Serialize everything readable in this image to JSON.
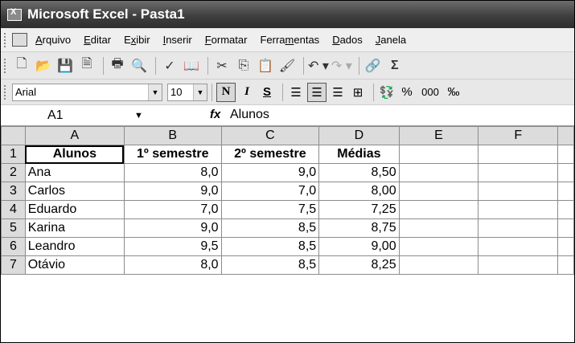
{
  "window": {
    "title": "Microsoft Excel - Pasta1"
  },
  "menu": [
    {
      "pre": "",
      "u": "A",
      "post": "rquivo"
    },
    {
      "pre": "",
      "u": "E",
      "post": "ditar"
    },
    {
      "pre": "E",
      "u": "x",
      "post": "ibir"
    },
    {
      "pre": "",
      "u": "I",
      "post": "nserir"
    },
    {
      "pre": "",
      "u": "F",
      "post": "ormatar"
    },
    {
      "pre": "Ferra",
      "u": "m",
      "post": "entas"
    },
    {
      "pre": "",
      "u": "D",
      "post": "ados"
    },
    {
      "pre": "",
      "u": "J",
      "post": "anela"
    }
  ],
  "format_toolbar": {
    "font": "Arial",
    "size": "10",
    "bold": "N",
    "italic": "I",
    "underline": "S",
    "percent": "%",
    "thousands": "000",
    "decimal": "‰"
  },
  "standard_toolbar": {
    "sum": "Σ"
  },
  "formula_bar": {
    "name_box": "A1",
    "fx": "fx",
    "value": "Alunos"
  },
  "columns": [
    "A",
    "B",
    "C",
    "D",
    "E",
    "F"
  ],
  "rows": [
    {
      "n": "1",
      "a": "Alunos",
      "b": "1º semestre",
      "c": "2º semestre",
      "d": "Médias"
    },
    {
      "n": "2",
      "a": "Ana",
      "b": "8,0",
      "c": "9,0",
      "d": "8,50"
    },
    {
      "n": "3",
      "a": "Carlos",
      "b": "9,0",
      "c": "7,0",
      "d": "8,00"
    },
    {
      "n": "4",
      "a": "Eduardo",
      "b": "7,0",
      "c": "7,5",
      "d": "7,25"
    },
    {
      "n": "5",
      "a": "Karina",
      "b": "9,0",
      "c": "8,5",
      "d": "8,75"
    },
    {
      "n": "6",
      "a": "Leandro",
      "b": "9,5",
      "c": "8,5",
      "d": "9,00"
    },
    {
      "n": "7",
      "a": "Otávio",
      "b": "8,0",
      "c": "8,5",
      "d": "8,25"
    }
  ]
}
